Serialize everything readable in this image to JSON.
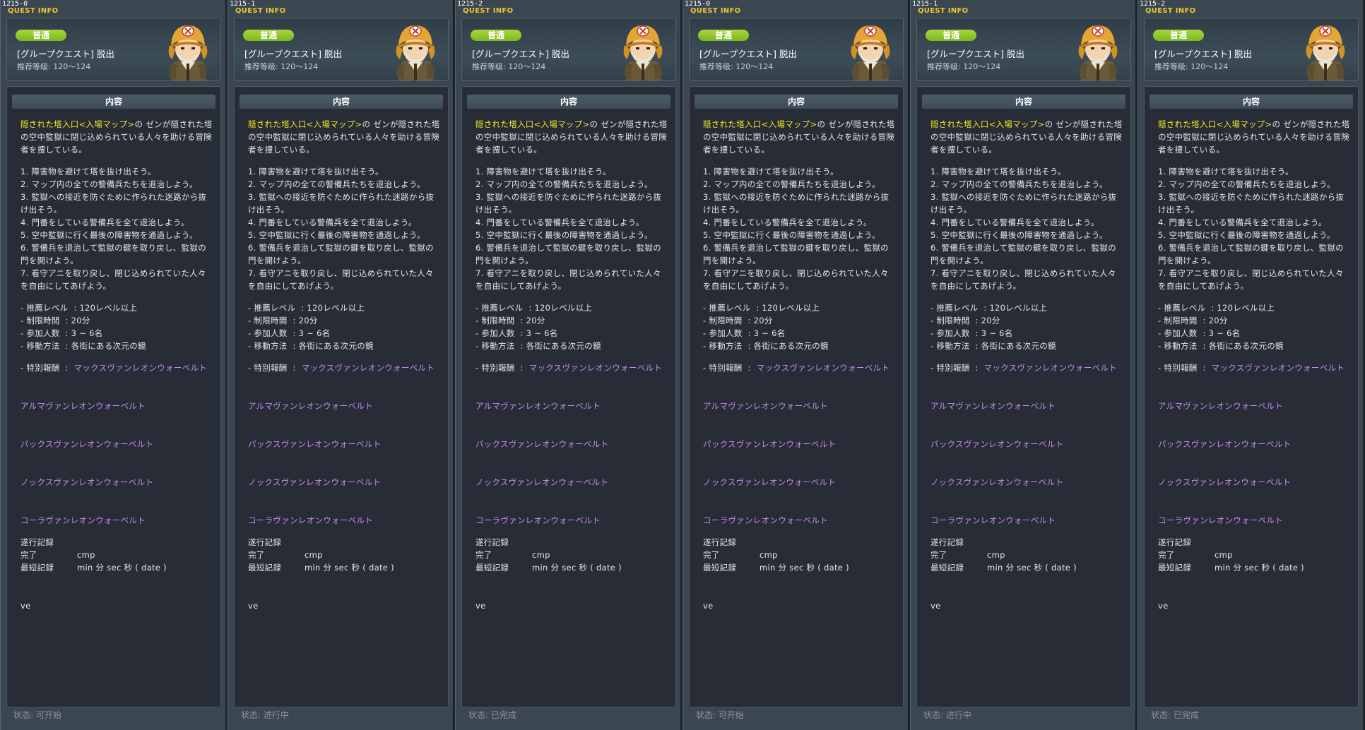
{
  "panels": [
    {
      "id": "1215-0",
      "status": "状态:  可开始"
    },
    {
      "id": "1215-1",
      "status": "状态:  进行中"
    },
    {
      "id": "1215-2",
      "status": "状态:  已完成"
    },
    {
      "id": "1215-0",
      "status": "状态:  可开始"
    },
    {
      "id": "1215-1",
      "status": "状态:  进行中"
    },
    {
      "id": "1215-2",
      "status": "状态:  已完成"
    }
  ],
  "panel_title": "QUEST INFO",
  "badge": "普通",
  "quest_name": "[グループクエスト] 脱出",
  "quest_level": "推荐等级: 120～124",
  "portrait_icon": "npc-portrait-icon",
  "content_header": "内容",
  "intro_highlight": "隠された塔入口<入場マップ>",
  "intro_rest": "の ゼンが隠された塔の空中監獄に閉じ込められている人々を助ける冒険者を捜している。",
  "steps": [
    "1. 障害物を避けて塔を抜け出そう。",
    "2. マップ内の全ての警備兵たちを退治しよう。",
    "3. 監獄への接近を防ぐために作られた迷路から抜け出そう。",
    "4. 門番をしている警備兵を全て退治しよう。",
    "5. 空中監獄に行く最後の障害物を通過しよう。",
    "6. 警備兵を退治して監獄の鍵を取り戻し、監獄の門を開けよう。",
    "7. 看守アニを取り戻し、閉じ込められていた人々を自由にしてあげよう。"
  ],
  "info": [
    "- 推薦レベル  : 120レベル以上",
    "- 制限時間  : 20分",
    "- 参加人数  : 3 ~ 6名",
    "- 移動方法  : 各街にある次元の鏡"
  ],
  "special_reward_label": "- 特別報酬  :  ",
  "rewards": [
    "マックスヴァンレオンウォーベルト",
    "アルマヴァンレオンウォーベルト",
    "パックスヴァンレオンウォーベルト",
    "ノックスヴァンレオンウォーベルト",
    "コーラヴァンレオンウォーベルト"
  ],
  "record_title": "遂行記録",
  "record_complete_label": "完了",
  "record_complete_value": "cmp",
  "record_best_label": "最短記録",
  "record_best_value": "min 分 sec 秒 ( date )",
  "footer_code": "ve",
  "colors": {
    "highlight": "#f2ea22",
    "reward": "#c58cf0",
    "badge": "#8bc72a",
    "title": "#f0c830"
  }
}
